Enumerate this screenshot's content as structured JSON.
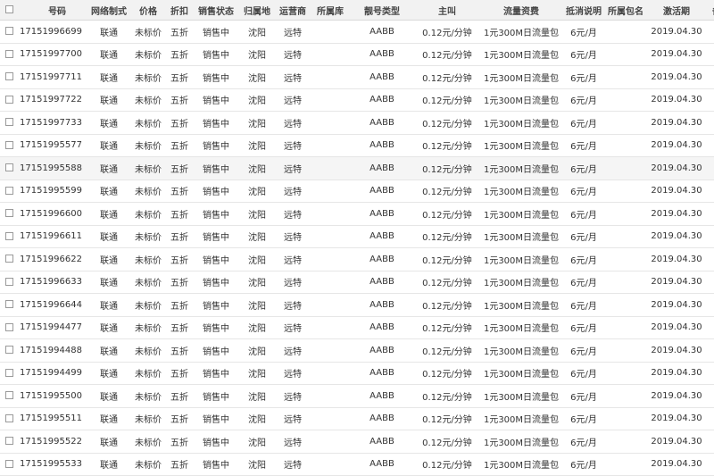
{
  "columns": [
    "号码",
    "网络制式",
    "价格",
    "折扣",
    "销售状态",
    "归属地",
    "运营商",
    "所属库",
    "靓号类型",
    "主叫",
    "流量资费",
    "抵消说明",
    "所属包名",
    "激活期",
    "备注"
  ],
  "rows": [
    {
      "num": "17151996699",
      "net": "联通",
      "price": "未标价",
      "discount": "五折",
      "status": "销售中",
      "loc": "沈阳",
      "carrier": "远特",
      "lib": "",
      "type": "AABB",
      "call": "0.12元/分钟",
      "flow": "1元300M日流量包",
      "offset": "6元/月",
      "pkg": "",
      "active": "2019.04.30",
      "note": ""
    },
    {
      "num": "17151997700",
      "net": "联通",
      "price": "未标价",
      "discount": "五折",
      "status": "销售中",
      "loc": "沈阳",
      "carrier": "远特",
      "lib": "",
      "type": "AABB",
      "call": "0.12元/分钟",
      "flow": "1元300M日流量包",
      "offset": "6元/月",
      "pkg": "",
      "active": "2019.04.30",
      "note": ""
    },
    {
      "num": "17151997711",
      "net": "联通",
      "price": "未标价",
      "discount": "五折",
      "status": "销售中",
      "loc": "沈阳",
      "carrier": "远特",
      "lib": "",
      "type": "AABB",
      "call": "0.12元/分钟",
      "flow": "1元300M日流量包",
      "offset": "6元/月",
      "pkg": "",
      "active": "2019.04.30",
      "note": ""
    },
    {
      "num": "17151997722",
      "net": "联通",
      "price": "未标价",
      "discount": "五折",
      "status": "销售中",
      "loc": "沈阳",
      "carrier": "远特",
      "lib": "",
      "type": "AABB",
      "call": "0.12元/分钟",
      "flow": "1元300M日流量包",
      "offset": "6元/月",
      "pkg": "",
      "active": "2019.04.30",
      "note": ""
    },
    {
      "num": "17151997733",
      "net": "联通",
      "price": "未标价",
      "discount": "五折",
      "status": "销售中",
      "loc": "沈阳",
      "carrier": "远特",
      "lib": "",
      "type": "AABB",
      "call": "0.12元/分钟",
      "flow": "1元300M日流量包",
      "offset": "6元/月",
      "pkg": "",
      "active": "2019.04.30",
      "note": ""
    },
    {
      "num": "17151995577",
      "net": "联通",
      "price": "未标价",
      "discount": "五折",
      "status": "销售中",
      "loc": "沈阳",
      "carrier": "远特",
      "lib": "",
      "type": "AABB",
      "call": "0.12元/分钟",
      "flow": "1元300M日流量包",
      "offset": "6元/月",
      "pkg": "",
      "active": "2019.04.30",
      "note": ""
    },
    {
      "num": "17151995588",
      "net": "联通",
      "price": "未标价",
      "discount": "五折",
      "status": "销售中",
      "loc": "沈阳",
      "carrier": "远特",
      "lib": "",
      "type": "AABB",
      "call": "0.12元/分钟",
      "flow": "1元300M日流量包",
      "offset": "6元/月",
      "pkg": "",
      "active": "2019.04.30",
      "note": ""
    },
    {
      "num": "17151995599",
      "net": "联通",
      "price": "未标价",
      "discount": "五折",
      "status": "销售中",
      "loc": "沈阳",
      "carrier": "远特",
      "lib": "",
      "type": "AABB",
      "call": "0.12元/分钟",
      "flow": "1元300M日流量包",
      "offset": "6元/月",
      "pkg": "",
      "active": "2019.04.30",
      "note": ""
    },
    {
      "num": "17151996600",
      "net": "联通",
      "price": "未标价",
      "discount": "五折",
      "status": "销售中",
      "loc": "沈阳",
      "carrier": "远特",
      "lib": "",
      "type": "AABB",
      "call": "0.12元/分钟",
      "flow": "1元300M日流量包",
      "offset": "6元/月",
      "pkg": "",
      "active": "2019.04.30",
      "note": ""
    },
    {
      "num": "17151996611",
      "net": "联通",
      "price": "未标价",
      "discount": "五折",
      "status": "销售中",
      "loc": "沈阳",
      "carrier": "远特",
      "lib": "",
      "type": "AABB",
      "call": "0.12元/分钟",
      "flow": "1元300M日流量包",
      "offset": "6元/月",
      "pkg": "",
      "active": "2019.04.30",
      "note": ""
    },
    {
      "num": "17151996622",
      "net": "联通",
      "price": "未标价",
      "discount": "五折",
      "status": "销售中",
      "loc": "沈阳",
      "carrier": "远特",
      "lib": "",
      "type": "AABB",
      "call": "0.12元/分钟",
      "flow": "1元300M日流量包",
      "offset": "6元/月",
      "pkg": "",
      "active": "2019.04.30",
      "note": ""
    },
    {
      "num": "17151996633",
      "net": "联通",
      "price": "未标价",
      "discount": "五折",
      "status": "销售中",
      "loc": "沈阳",
      "carrier": "远特",
      "lib": "",
      "type": "AABB",
      "call": "0.12元/分钟",
      "flow": "1元300M日流量包",
      "offset": "6元/月",
      "pkg": "",
      "active": "2019.04.30",
      "note": ""
    },
    {
      "num": "17151996644",
      "net": "联通",
      "price": "未标价",
      "discount": "五折",
      "status": "销售中",
      "loc": "沈阳",
      "carrier": "远特",
      "lib": "",
      "type": "AABB",
      "call": "0.12元/分钟",
      "flow": "1元300M日流量包",
      "offset": "6元/月",
      "pkg": "",
      "active": "2019.04.30",
      "note": ""
    },
    {
      "num": "17151994477",
      "net": "联通",
      "price": "未标价",
      "discount": "五折",
      "status": "销售中",
      "loc": "沈阳",
      "carrier": "远特",
      "lib": "",
      "type": "AABB",
      "call": "0.12元/分钟",
      "flow": "1元300M日流量包",
      "offset": "6元/月",
      "pkg": "",
      "active": "2019.04.30",
      "note": ""
    },
    {
      "num": "17151994488",
      "net": "联通",
      "price": "未标价",
      "discount": "五折",
      "status": "销售中",
      "loc": "沈阳",
      "carrier": "远特",
      "lib": "",
      "type": "AABB",
      "call": "0.12元/分钟",
      "flow": "1元300M日流量包",
      "offset": "6元/月",
      "pkg": "",
      "active": "2019.04.30",
      "note": ""
    },
    {
      "num": "17151994499",
      "net": "联通",
      "price": "未标价",
      "discount": "五折",
      "status": "销售中",
      "loc": "沈阳",
      "carrier": "远特",
      "lib": "",
      "type": "AABB",
      "call": "0.12元/分钟",
      "flow": "1元300M日流量包",
      "offset": "6元/月",
      "pkg": "",
      "active": "2019.04.30",
      "note": ""
    },
    {
      "num": "17151995500",
      "net": "联通",
      "price": "未标价",
      "discount": "五折",
      "status": "销售中",
      "loc": "沈阳",
      "carrier": "远特",
      "lib": "",
      "type": "AABB",
      "call": "0.12元/分钟",
      "flow": "1元300M日流量包",
      "offset": "6元/月",
      "pkg": "",
      "active": "2019.04.30",
      "note": ""
    },
    {
      "num": "17151995511",
      "net": "联通",
      "price": "未标价",
      "discount": "五折",
      "status": "销售中",
      "loc": "沈阳",
      "carrier": "远特",
      "lib": "",
      "type": "AABB",
      "call": "0.12元/分钟",
      "flow": "1元300M日流量包",
      "offset": "6元/月",
      "pkg": "",
      "active": "2019.04.30",
      "note": ""
    },
    {
      "num": "17151995522",
      "net": "联通",
      "price": "未标价",
      "discount": "五折",
      "status": "销售中",
      "loc": "沈阳",
      "carrier": "远特",
      "lib": "",
      "type": "AABB",
      "call": "0.12元/分钟",
      "flow": "1元300M日流量包",
      "offset": "6元/月",
      "pkg": "",
      "active": "2019.04.30",
      "note": ""
    },
    {
      "num": "17151995533",
      "net": "联通",
      "price": "未标价",
      "discount": "五折",
      "status": "销售中",
      "loc": "沈阳",
      "carrier": "远特",
      "lib": "",
      "type": "AABB",
      "call": "0.12元/分钟",
      "flow": "1元300M日流量包",
      "offset": "6元/月",
      "pkg": "",
      "active": "2019.04.30",
      "note": ""
    }
  ]
}
